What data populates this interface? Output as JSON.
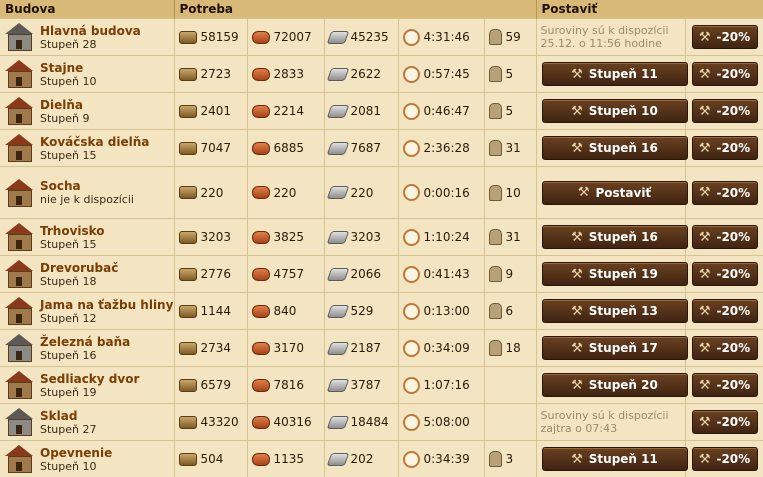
{
  "headers": {
    "building": "Budova",
    "cost": "Potreba",
    "build": "Postaviť"
  },
  "discount": "-20%",
  "rows": [
    {
      "name": "Hlavná budova",
      "level": "Stupeň 28",
      "wood": "58159",
      "clay": "72007",
      "iron": "45235",
      "time": "4:31:46",
      "pop": "59",
      "note": "Suroviny sú k dispozícii 25.12. o 11:56 hodine"
    },
    {
      "name": "Stajne",
      "level": "Stupeň 10",
      "wood": "2723",
      "clay": "2833",
      "iron": "2622",
      "time": "0:57:45",
      "pop": "5",
      "button": "Stupeň 11"
    },
    {
      "name": "Dielňa",
      "level": "Stupeň 9",
      "wood": "2401",
      "clay": "2214",
      "iron": "2081",
      "time": "0:46:47",
      "pop": "5",
      "button": "Stupeň 10"
    },
    {
      "name": "Kováčska dielňa",
      "level": "Stupeň 15",
      "wood": "7047",
      "clay": "6885",
      "iron": "7687",
      "time": "2:36:28",
      "pop": "31",
      "button": "Stupeň 16"
    },
    {
      "name": "Socha",
      "level": "nie je k dispozícii",
      "wood": "220",
      "clay": "220",
      "iron": "220",
      "time": "0:00:16",
      "pop": "10",
      "button": "Postaviť"
    },
    {
      "name": "Trhovisko",
      "level": "Stupeň 15",
      "wood": "3203",
      "clay": "3825",
      "iron": "3203",
      "time": "1:10:24",
      "pop": "31",
      "button": "Stupeň 16"
    },
    {
      "name": "Drevorubač",
      "level": "Stupeň 18",
      "wood": "2776",
      "clay": "4757",
      "iron": "2066",
      "time": "0:41:43",
      "pop": "9",
      "button": "Stupeň 19"
    },
    {
      "name": "Jama na ťažbu hliny",
      "level": "Stupeň 12",
      "wood": "1144",
      "clay": "840",
      "iron": "529",
      "time": "0:13:00",
      "pop": "6",
      "button": "Stupeň 13"
    },
    {
      "name": "Železná baňa",
      "level": "Stupeň 16",
      "wood": "2734",
      "clay": "3170",
      "iron": "2187",
      "time": "0:34:09",
      "pop": "18",
      "button": "Stupeň 17"
    },
    {
      "name": "Sedliacky dvor",
      "level": "Stupeň 19",
      "wood": "6579",
      "clay": "7816",
      "iron": "3787",
      "time": "1:07:16",
      "pop": "",
      "button": "Stupeň 20"
    },
    {
      "name": "Sklad",
      "level": "Stupeň 27",
      "wood": "43320",
      "clay": "40316",
      "iron": "18484",
      "time": "5:08:00",
      "pop": "",
      "note": "Suroviny sú k dispozícii zajtra o 07:43"
    },
    {
      "name": "Opevnenie",
      "level": "Stupeň 10",
      "wood": "504",
      "clay": "1135",
      "iron": "202",
      "time": "0:34:39",
      "pop": "3",
      "button": "Stupeň 11"
    }
  ]
}
